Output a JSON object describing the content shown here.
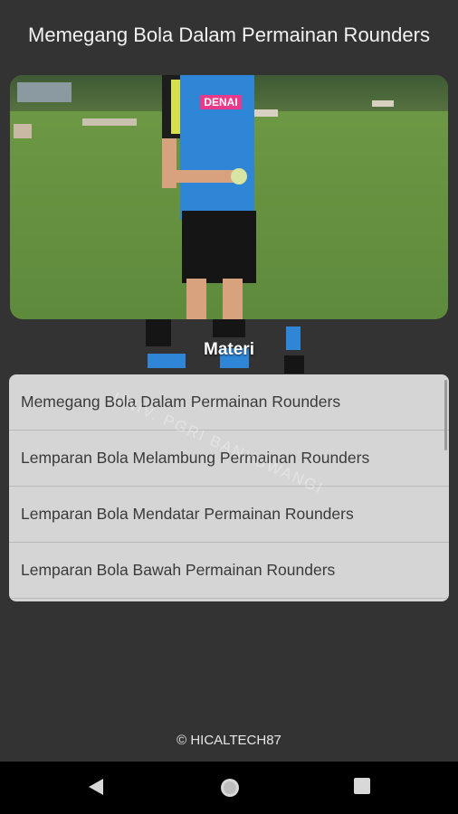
{
  "header": {
    "title": "Memegang Bola Dalam Permainan Rounders"
  },
  "video": {
    "shirt_text": "DENAI"
  },
  "section": {
    "title": "Materi"
  },
  "list": {
    "items": [
      {
        "label": "Memegang Bola Dalam Permainan Rounders"
      },
      {
        "label": "Lemparan Bola Melambung Permainan Rounders"
      },
      {
        "label": "Lemparan Bola Mendatar Permainan Rounders"
      },
      {
        "label": "Lemparan Bola Bawah Permainan Rounders"
      }
    ]
  },
  "watermark": {
    "text": "UNIV. PGRI BANYUWANGI"
  },
  "footer": {
    "copyright": "© HICALTECH87"
  },
  "navigation": {
    "back_icon": "back-triangle-icon",
    "home_icon": "home-circle-icon",
    "recents_icon": "recents-square-icon"
  },
  "colors": {
    "background": "#333333",
    "list_bg": "#d5d5d5",
    "navbar": "#000000"
  }
}
